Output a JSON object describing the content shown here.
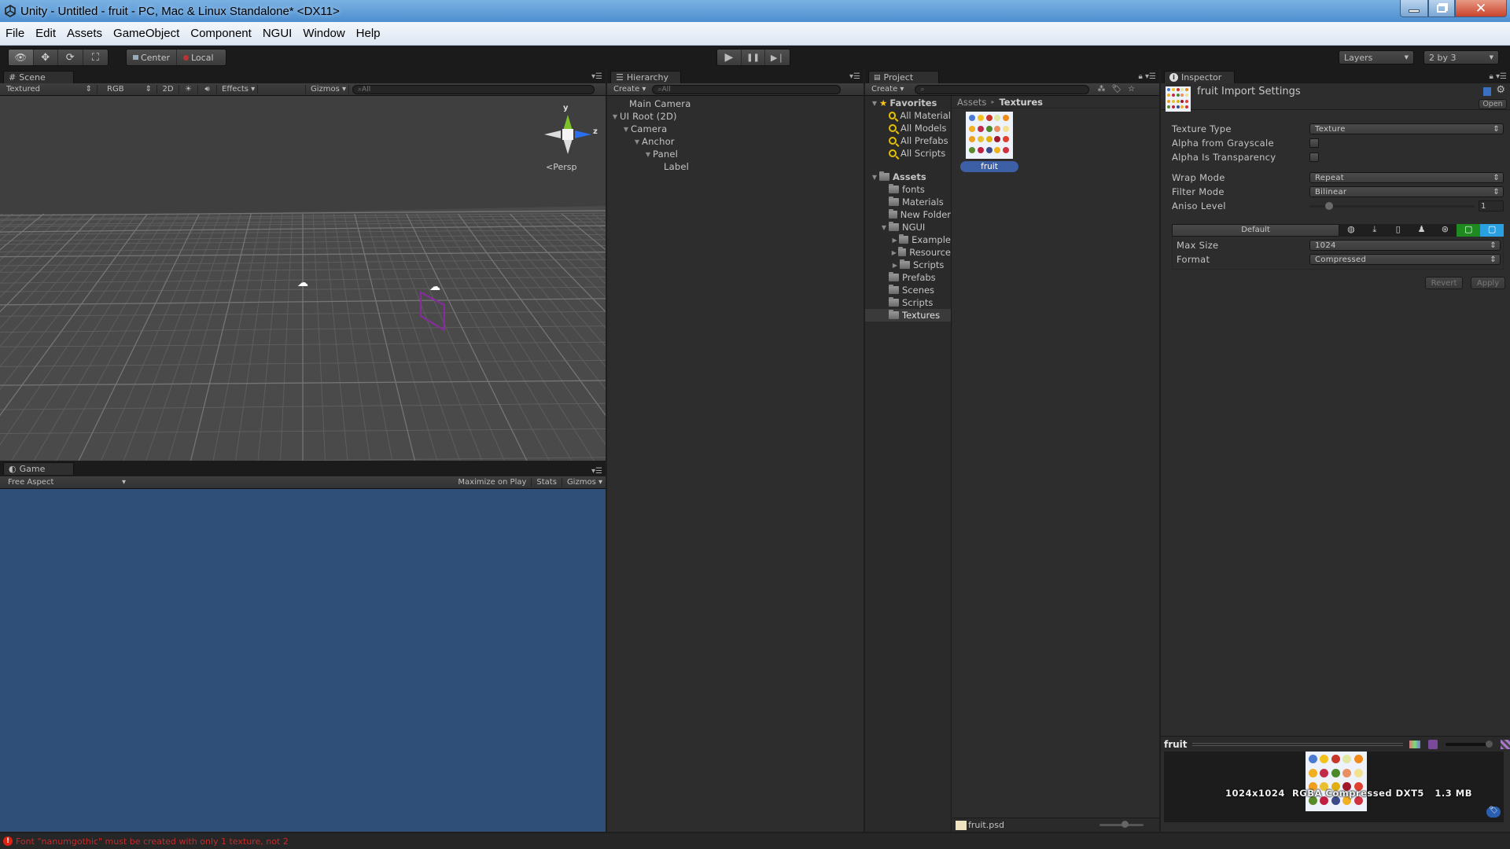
{
  "window": {
    "title": "Unity - Untitled - fruit - PC, Mac & Linux Standalone* <DX11>",
    "controls": {
      "minimize": "minimize",
      "maximize": "restore",
      "close": "close"
    }
  },
  "menu": [
    "File",
    "Edit",
    "Assets",
    "GameObject",
    "Component",
    "NGUI",
    "Window",
    "Help"
  ],
  "toolbar": {
    "tools": [
      {
        "name": "view-tool",
        "glyph": "👁",
        "active": true
      },
      {
        "name": "move-tool",
        "glyph": "✥",
        "active": false
      },
      {
        "name": "rotate-tool",
        "glyph": "⟳",
        "active": false
      },
      {
        "name": "scale-tool",
        "glyph": "⛶",
        "active": false
      }
    ],
    "pivot": "Center",
    "space": "Local",
    "play": "▶",
    "pause": "❚❚",
    "step": "▶❘",
    "layers": "Layers",
    "layout": "2 by 3"
  },
  "scene": {
    "tab": "Scene",
    "draw_mode": "Textured",
    "render_mode": "RGB",
    "mode_2d": "2D",
    "effects": "Effects",
    "gizmos": "Gizmos",
    "search_placeholder": "All",
    "gizmo": {
      "y": "y",
      "z": "z",
      "projection": "Persp"
    }
  },
  "game": {
    "tab": "Game",
    "aspect": "Free Aspect",
    "maximize_on_play": "Maximize on Play",
    "stats": "Stats",
    "gizmos": "Gizmos",
    "background": "#2f4f78"
  },
  "hierarchy": {
    "tab": "Hierarchy",
    "create": "Create",
    "search_placeholder": "All",
    "items": [
      {
        "label": "Main Camera",
        "depth": 0,
        "expanded": null
      },
      {
        "label": "UI Root (2D)",
        "depth": 0,
        "expanded": true
      },
      {
        "label": "Camera",
        "depth": 1,
        "expanded": true
      },
      {
        "label": "Anchor",
        "depth": 2,
        "expanded": true
      },
      {
        "label": "Panel",
        "depth": 3,
        "expanded": true
      },
      {
        "label": "Label",
        "depth": 4,
        "expanded": null
      }
    ]
  },
  "project": {
    "tab": "Project",
    "create": "Create",
    "favorites_label": "Favorites",
    "favorites": [
      "All Material",
      "All Models",
      "All Prefabs",
      "All Scripts"
    ],
    "assets_label": "Assets",
    "folders": [
      {
        "label": "fonts",
        "depth": 1,
        "expandable": false
      },
      {
        "label": "Materials",
        "depth": 1,
        "expandable": false
      },
      {
        "label": "New Folder",
        "depth": 1,
        "expandable": false
      },
      {
        "label": "NGUI",
        "depth": 1,
        "expandable": true,
        "expanded": true
      },
      {
        "label": "Example",
        "depth": 2,
        "expandable": true,
        "expanded": false
      },
      {
        "label": "Resource",
        "depth": 2,
        "expandable": true,
        "expanded": false
      },
      {
        "label": "Scripts",
        "depth": 2,
        "expandable": true,
        "expanded": false
      },
      {
        "label": "Prefabs",
        "depth": 1,
        "expandable": false
      },
      {
        "label": "Scenes",
        "depth": 1,
        "expandable": false
      },
      {
        "label": "Scripts",
        "depth": 1,
        "expandable": false
      },
      {
        "label": "Textures",
        "depth": 1,
        "expandable": false,
        "selected": true
      }
    ],
    "breadcrumb": [
      "Assets",
      "Textures"
    ],
    "asset_items": [
      {
        "label": "fruit",
        "selected": true
      }
    ],
    "footer_file": "fruit.psd"
  },
  "inspector": {
    "tab": "Inspector",
    "header_title": "fruit Import Settings",
    "open_button": "Open",
    "fields": {
      "texture_type": {
        "label": "Texture Type",
        "value": "Texture"
      },
      "alpha_from_grayscale": {
        "label": "Alpha from Grayscale",
        "checked": false
      },
      "alpha_is_transparency": {
        "label": "Alpha Is Transparency",
        "checked": false
      },
      "wrap_mode": {
        "label": "Wrap Mode",
        "value": "Repeat"
      },
      "filter_mode": {
        "label": "Filter Mode",
        "value": "Bilinear"
      },
      "aniso_level": {
        "label": "Aniso Level",
        "value": "1",
        "slider_fraction": 0.1
      }
    },
    "platform_tabs": [
      "Default",
      "web",
      "standalone",
      "ios",
      "android",
      "blackberry",
      "xbox",
      "windows-store"
    ],
    "platform_default_label": "Default",
    "max_size": {
      "label": "Max Size",
      "value": "1024"
    },
    "format": {
      "label": "Format",
      "value": "Compressed"
    },
    "revert": "Revert",
    "apply": "Apply",
    "preview": {
      "name": "fruit",
      "info": "1024x1024  RGBA Compressed DXT5   1.3 MB"
    }
  },
  "status": {
    "message": "Font \"nanumgothic\" must be created with only 1 texture, not 2",
    "color": "#c42b2b"
  }
}
